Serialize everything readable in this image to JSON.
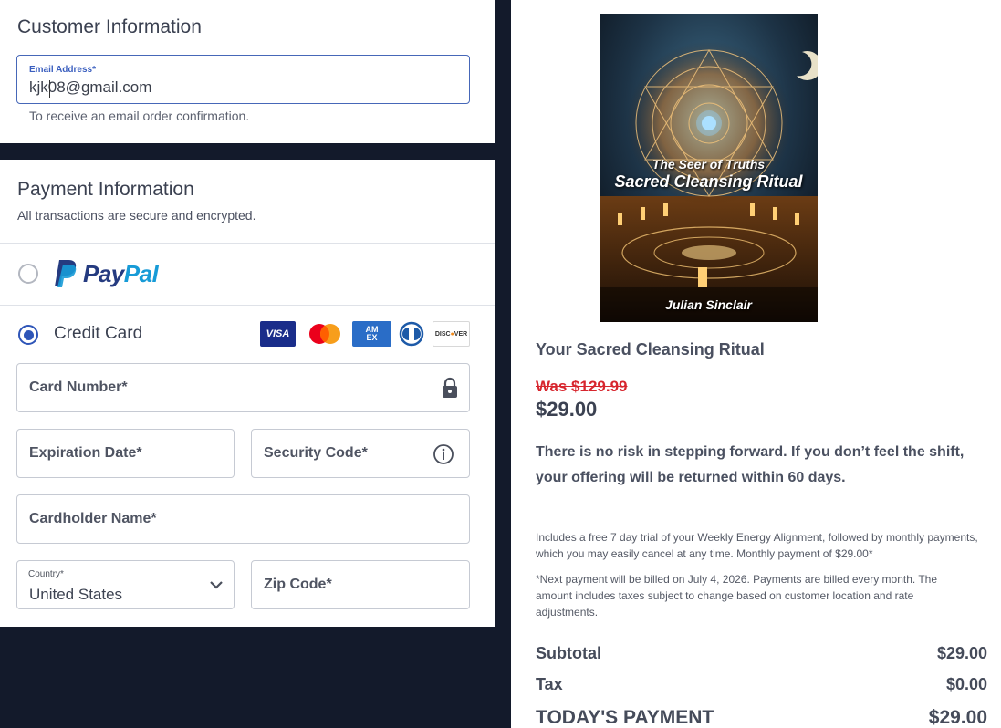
{
  "customer": {
    "heading": "Customer Information",
    "email_label": "Email Address*",
    "email_value": "kjk08@gmail.com",
    "hint": "To receive an email order confirmation."
  },
  "payment": {
    "heading": "Payment Information",
    "subtitle": "All transactions are secure and encrypted.",
    "paypal_label": "PayPal",
    "credit_label": "Credit Card",
    "selected_method": "credit-card",
    "card_brands": [
      "VISA",
      "Mastercard",
      "AMEX",
      "Diners",
      "DISCOVER"
    ],
    "card_number_ph": "Card Number*",
    "expiration_ph": "Expiration Date*",
    "security_ph": "Security Code*",
    "cardholder_ph": "Cardholder Name*",
    "country_label": "Country*",
    "country_value": "United States",
    "zip_ph": "Zip Code*"
  },
  "order": {
    "cover_series": "The Seer of Truths",
    "cover_title": "Sacred Cleansing Ritual",
    "cover_author": "Julian Sinclair",
    "product_title": "Your Sacred Cleansing Ritual",
    "was_price": "Was $129.99",
    "price": "$29.00",
    "guarantee": "There is no risk in stepping forward. If you don’t feel the shift, your offering will be returned within 60 days.",
    "fine1": "Includes a free 7 day trial of your Weekly Energy Alignment, followed by monthly payments, which you may easily cancel at any time. Monthly payment of $29.00*",
    "fine2": "*Next payment will be billed on July 4, 2026. Payments are billed every month. The amount includes taxes subject to change based on customer location and rate adjustments.",
    "subtotal_label": "Subtotal",
    "subtotal_value": "$29.00",
    "tax_label": "Tax",
    "tax_value": "$0.00",
    "total_label": "TODAY'S PAYMENT",
    "total_value": "$29.00"
  },
  "colors": {
    "page_bg": "#131a2b",
    "accent": "#2e55b8",
    "was_red": "#d7262e",
    "paypal_dark": "#253b80",
    "paypal_light": "#179bd7"
  }
}
